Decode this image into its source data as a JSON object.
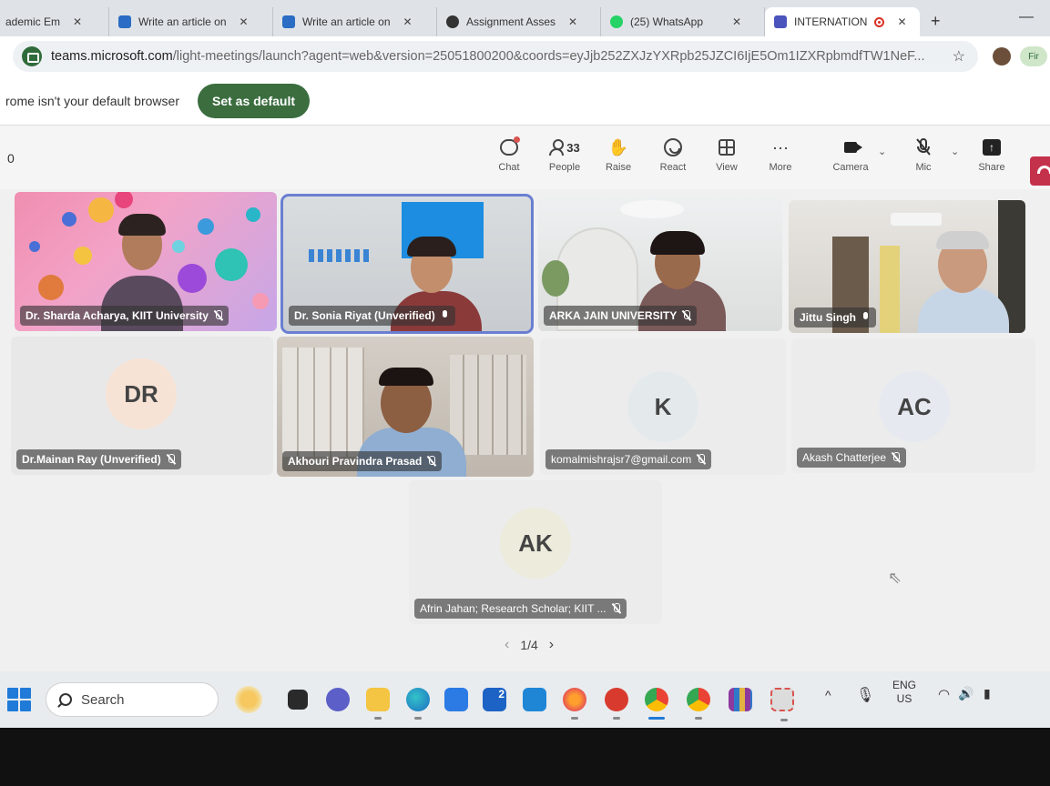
{
  "browser": {
    "tabs": [
      {
        "title": "ademic Em",
        "active": false
      },
      {
        "title": "Write an article on",
        "active": false
      },
      {
        "title": "Write an article on",
        "active": false
      },
      {
        "title": "Assignment Asses",
        "active": false
      },
      {
        "title": "(25) WhatsApp",
        "active": false
      },
      {
        "title": "INTERNATION",
        "active": true
      }
    ],
    "close_glyph": "✕",
    "new_tab": "+",
    "minimize": "—",
    "url_host": "teams.microsoft.com",
    "url_path": "/light-meetings/launch?agent=web&version=25051800200&coords=eyJjb252ZXJzYXRpb25JZCI6IjE5Om1IZXRpbmdfTW1NeF...",
    "profile_label": "Fir"
  },
  "infobar": {
    "message": "rome isn't your default browser",
    "button_label": "Set as default"
  },
  "meeting_bar": {
    "timer": "0",
    "chat_label": "Chat",
    "people_label": "People",
    "people_count": "33",
    "raise_label": "Raise",
    "react_label": "React",
    "view_label": "View",
    "more_label": "More",
    "more_glyph": "···",
    "camera_label": "Camera",
    "mic_label": "Mic",
    "share_label": "Share",
    "share_glyph": "↑",
    "chevron": "⌄"
  },
  "participants": [
    {
      "name": "Dr. Sharda Acharya, KIIT University",
      "mic": "off",
      "video": true
    },
    {
      "name": "Dr. Sonia Riyat (Unverified)",
      "mic": "on",
      "video": true,
      "speaking": true
    },
    {
      "name": "ARKA JAIN UNIVERSITY",
      "mic": "off",
      "video": true
    },
    {
      "name": "Jittu Singh",
      "mic": "on",
      "video": true
    },
    {
      "name": "Dr.Mainan Ray (Unverified)",
      "mic": "off",
      "video": false,
      "initials": "DR"
    },
    {
      "name": "Akhouri Pravindra Prasad",
      "mic": "off",
      "video": true
    },
    {
      "name": "komalmishrajsr7@gmail.com",
      "mic": "off",
      "video": false,
      "initials": "K"
    },
    {
      "name": "Akash Chatterjee",
      "mic": "off",
      "video": false,
      "initials": "AC"
    },
    {
      "name": "Afrin Jahan; Research Scholar; KIIT ...",
      "mic": "off",
      "video": false,
      "initials": "AK"
    }
  ],
  "pager": {
    "text": "1/4",
    "prev": "‹",
    "next": "›"
  },
  "taskbar": {
    "search_label": "Search",
    "tray_chevron": "^",
    "lang_top": "ENG",
    "lang_bottom": "US",
    "store_badge": "2"
  },
  "colors": {
    "accent": "#6a7fd1",
    "default_button": "#3b6d3f",
    "leave": "#c4314b",
    "avatar_dr": "#f7e3d6",
    "avatar_k": "#e4eaec",
    "avatar_ac": "#e6eaf0",
    "avatar_ak": "#ecebdc"
  }
}
